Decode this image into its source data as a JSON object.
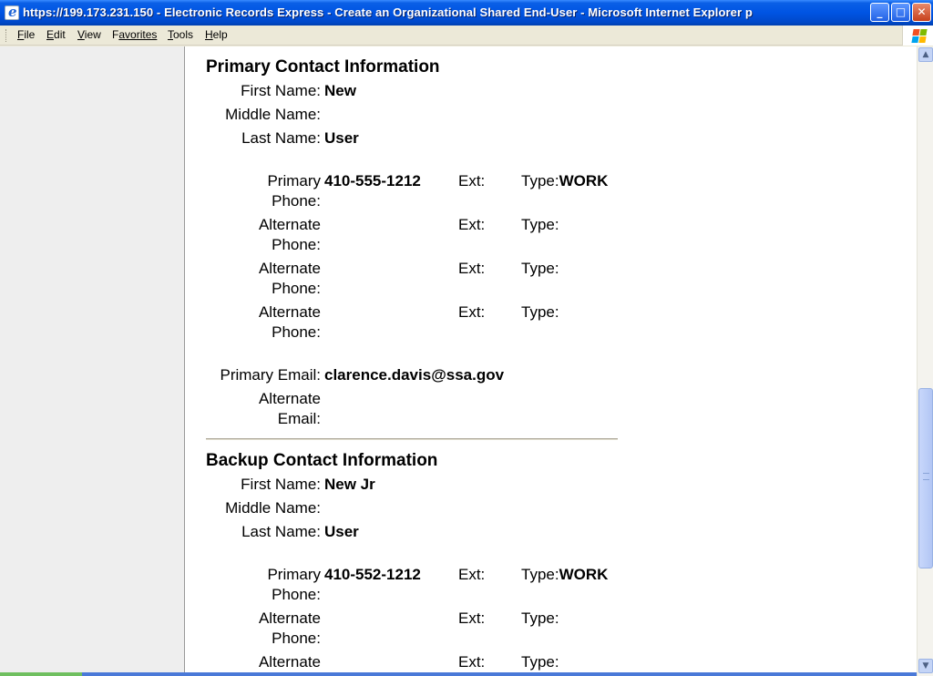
{
  "window": {
    "title": "https://199.173.231.150 - Electronic Records Express - Create an Organizational Shared End-User - Microsoft Internet Explorer p",
    "controls": {
      "minimize": "_",
      "maximize": "□",
      "close": "✕"
    }
  },
  "menubar": {
    "items": [
      {
        "accel": "F",
        "rest": "ile"
      },
      {
        "accel": "E",
        "rest": "dit"
      },
      {
        "accel": "V",
        "rest": "iew"
      },
      {
        "accel": "",
        "rest": "F",
        "rest2": "avorites"
      },
      {
        "accel": "T",
        "rest": "ools"
      },
      {
        "accel": "H",
        "rest": "elp"
      }
    ]
  },
  "primary": {
    "heading": "Primary Contact Information",
    "first_name_label": "First Name:",
    "first_name": "New",
    "middle_name_label": "Middle Name:",
    "middle_name": "",
    "last_name_label": "Last Name:",
    "last_name": "User",
    "phones": [
      {
        "label": "Primary Phone:",
        "number": "410-555-1212",
        "ext_label": "Ext:",
        "type_label": "Type:",
        "type": "WORK"
      },
      {
        "label": "Alternate Phone:",
        "number": "",
        "ext_label": "Ext:",
        "type_label": "Type:",
        "type": ""
      },
      {
        "label": "Alternate Phone:",
        "number": "",
        "ext_label": "Ext:",
        "type_label": "Type:",
        "type": ""
      },
      {
        "label": "Alternate Phone:",
        "number": "",
        "ext_label": "Ext:",
        "type_label": "Type:",
        "type": ""
      }
    ],
    "primary_email_label": "Primary Email:",
    "primary_email": "clarence.davis@ssa.gov",
    "alternate_email_label": "Alternate Email:",
    "alternate_email": ""
  },
  "backup": {
    "heading": "Backup Contact Information",
    "first_name_label": "First Name:",
    "first_name": "New Jr",
    "middle_name_label": "Middle Name:",
    "middle_name": "",
    "last_name_label": "Last Name:",
    "last_name": "User",
    "phones": [
      {
        "label": "Primary Phone:",
        "number": "410-552-1212",
        "ext_label": "Ext:",
        "type_label": "Type:",
        "type": "WORK"
      },
      {
        "label": "Alternate Phone:",
        "number": "",
        "ext_label": "Ext:",
        "type_label": "Type:",
        "type": ""
      },
      {
        "label": "Alternate",
        "number": "",
        "ext_label": "Ext:",
        "type_label": "Type:",
        "type": ""
      }
    ]
  },
  "scrollbar": {
    "up_arrow": "▲",
    "down_arrow": "▼",
    "scroll_position": 0.62
  },
  "colors": {
    "titlebar": "#0054E3",
    "left_pane": "#EEEEEE",
    "chrome": "#ECE9D8"
  }
}
